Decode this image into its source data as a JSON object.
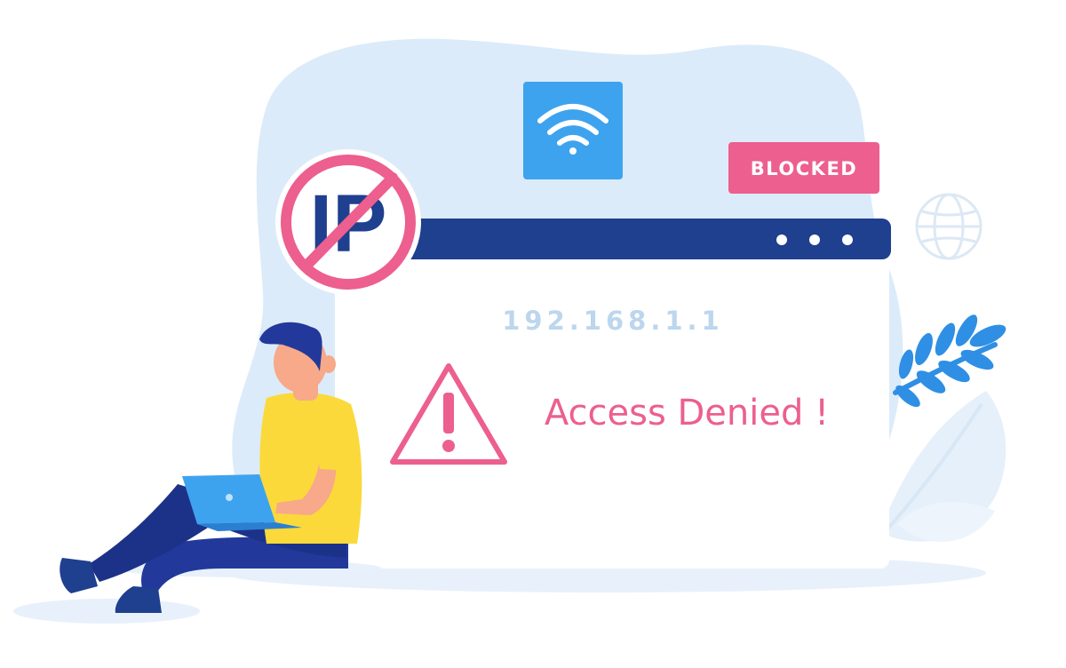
{
  "illustration": {
    "ip_badge_label": "IP",
    "blocked_label": "BLOCKED",
    "ip_address": "192.168.1.1",
    "message": "Access Denied !"
  },
  "colors": {
    "backdrop": "#dcebf9",
    "window_bar": "#1f3f8f",
    "alert_pink": "#ec5f8e",
    "wifi_tile": "#3ea3ef",
    "leaf_blue": "#2f8fe4",
    "shirt_yellow": "#fbd93a",
    "pants_navy": "#22399b",
    "skin": "#f7a98a"
  },
  "icons": [
    "wifi-icon",
    "no-ip-icon",
    "globe-icon",
    "warning-icon",
    "window-menu-icon",
    "leaf-branch-icon",
    "laptop-icon"
  ]
}
